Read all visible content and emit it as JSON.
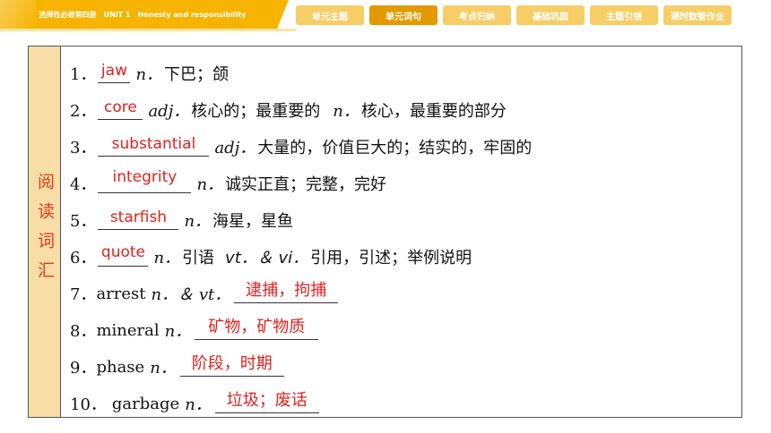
{
  "header": {
    "course_title": "选择性必修第四册　UNIT 1　Honesty and responsibility",
    "tabs": [
      {
        "label": "单元主题",
        "active": false
      },
      {
        "label": "单元词句",
        "active": true
      },
      {
        "label": "考点归纳",
        "active": false
      },
      {
        "label": "基础巩固",
        "active": false
      },
      {
        "label": "主题引领",
        "active": false
      },
      {
        "label": "课时数智作业",
        "active": false
      }
    ]
  },
  "colors": {
    "accent": "#F6B400",
    "active_tab": "#E39A00",
    "answer_red": "#E02020",
    "side_bg": "#F8DDA6"
  },
  "section": {
    "title": "阅读词汇"
  },
  "vocab": [
    {
      "num": "1．",
      "answer": "jaw",
      "pos": "n．",
      "meaning": "下巴；颌"
    },
    {
      "num": "2．",
      "answer": "core",
      "pos": "adj．",
      "meaning": "核心的；最重要的",
      "pos2": "n．",
      "meaning2": "核心，最重要的部分"
    },
    {
      "num": "3．",
      "answer": "substantial",
      "pos": "adj．",
      "meaning": "大量的，价值巨大的；结实的，牢固的"
    },
    {
      "num": "4．",
      "answer": "integrity",
      "pos": "n．",
      "meaning": "诚实正直；完整，完好"
    },
    {
      "num": "5．",
      "answer": "starfish",
      "pos": "n．",
      "meaning": "海星，星鱼"
    },
    {
      "num": "6．",
      "answer": "quote",
      "pos": "n．",
      "meaning": "引语",
      "pos2": "vt．＆ vi．",
      "meaning2": "引用，引述；举例说明"
    },
    {
      "num": "7．",
      "word": "arrest",
      "pos": "n．＆ vt．",
      "answer": "逮捕，拘捕"
    },
    {
      "num": "8．",
      "word": "mineral",
      "pos": "n．",
      "answer": "矿物，矿物质"
    },
    {
      "num": "9．",
      "word": "phase",
      "pos": "n．",
      "answer": "阶段，时期"
    },
    {
      "num": "10．",
      "word": "garbage",
      "pos": "n．",
      "answer": "垃圾；废话"
    }
  ]
}
